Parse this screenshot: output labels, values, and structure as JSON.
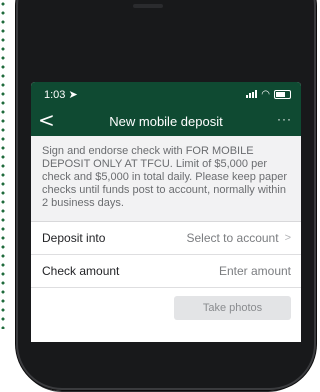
{
  "status": {
    "time": "1:03"
  },
  "nav": {
    "title": "New mobile deposit",
    "back_glyph": "<",
    "more_glyph": "···"
  },
  "instructions": "Sign and endorse check with FOR MOBILE DEPOSIT ONLY AT TFCU. Limit of $5,000 per check and $5,000 in total daily. Please keep paper checks until funds post to account, normally within 2 business days.",
  "form": {
    "deposit_into": {
      "label": "Deposit into",
      "value": "Select to account"
    },
    "check_amount": {
      "label": "Check amount",
      "placeholder": "Enter amount"
    }
  },
  "actions": {
    "take_photos": "Take photos"
  },
  "colors": {
    "header_green": "#0f4a32",
    "stitch_green": "#1f6b3c",
    "phone_body": "#18191b"
  }
}
